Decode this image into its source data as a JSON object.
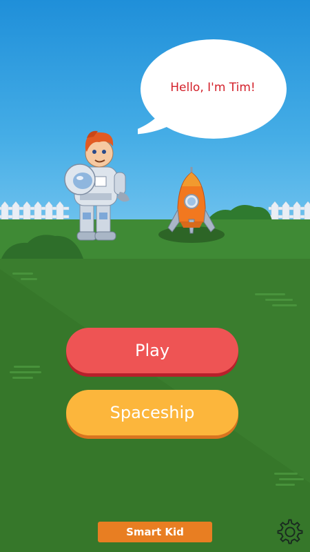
{
  "speech_bubble": {
    "text": "Hello, I'm Tim!"
  },
  "buttons": {
    "play_label": "Play",
    "spaceship_label": "Spaceship"
  },
  "brand": {
    "label": "Smart Kid"
  },
  "settings": {
    "icon": "gear-icon"
  },
  "colors": {
    "sky": "#45ade6",
    "grass": "#3a7d2e",
    "play_button": "#ee5454",
    "spaceship_button": "#fcb63c",
    "brand_badge": "#e87e22",
    "bubble_text": "#d3202a"
  }
}
